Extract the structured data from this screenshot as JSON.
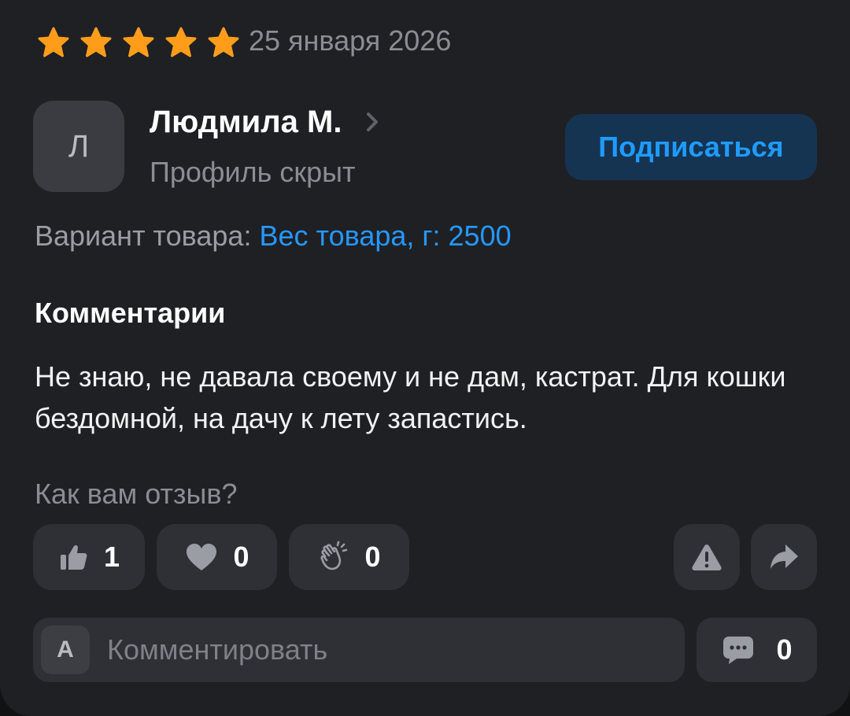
{
  "review": {
    "rating": 5,
    "rating_max": 5,
    "date": "25 января 2026"
  },
  "author": {
    "initial": "Л",
    "name": "Людмила М.",
    "profile_status": "Профиль скрыт"
  },
  "subscribe_label": "Подписаться",
  "variant": {
    "label": "Вариант товара:",
    "value": "Вес товара, г: 2500"
  },
  "comments_heading": "Комментарии",
  "comment_text": "Не знаю, не давала своему и не дам, кастрат. Для кошки бездомной, на дачу к лету запастись.",
  "feedback_question": "Как вам отзыв?",
  "reactions": {
    "like_count": "1",
    "heart_count": "0",
    "clap_count": "0"
  },
  "comment_input": {
    "avatar_initial": "А",
    "placeholder": "Комментировать"
  },
  "comments_count": "0",
  "colors": {
    "card_bg": "#1e2024",
    "star": "#ff9d1b",
    "accent_blue": "#1f9bff",
    "button_bg": "#2e3035"
  },
  "icons": [
    "star-icon",
    "chevron-right-icon",
    "thumbs-up-icon",
    "heart-icon",
    "clap-icon",
    "warning-icon",
    "share-icon",
    "comment-bubble-icon"
  ]
}
